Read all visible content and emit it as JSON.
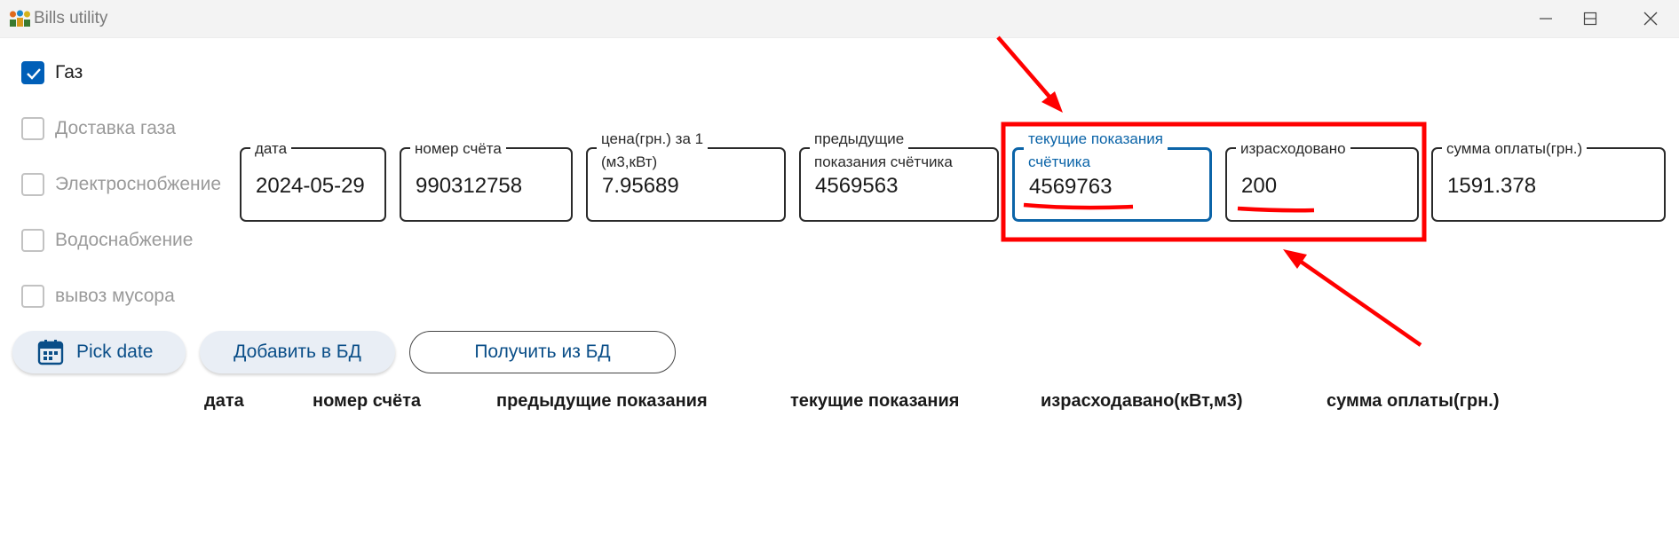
{
  "window": {
    "title": "Bills utility"
  },
  "checkboxes": [
    {
      "label": "Газ",
      "checked": true
    },
    {
      "label": "Доставка газа",
      "checked": false
    },
    {
      "label": "Электроснобжение",
      "checked": false
    },
    {
      "label": "Водоснабжение",
      "checked": false
    },
    {
      "label": "вывоз мусора",
      "checked": false
    }
  ],
  "fields": {
    "date": {
      "label": "дата",
      "value": "2024-05-29"
    },
    "account": {
      "label": "номер счёта",
      "value": "990312758"
    },
    "price": {
      "label_line1": "цена(грн.) за 1",
      "label_line2": "(м3,кВт)",
      "value": "7.95689"
    },
    "previous": {
      "label_line1": "предыдущие",
      "label_line2": "показания счётчика",
      "value": "4569563"
    },
    "current": {
      "label_line1": "текущие показания",
      "label_line2": "счётчика",
      "value": "4569763"
    },
    "consumed": {
      "label": "израсходовано",
      "value": "200"
    },
    "total": {
      "label": "сумма оплаты(грн.)",
      "value": "1591.378"
    }
  },
  "buttons": {
    "pick_date": "Pick date",
    "add_db": "Добавить в БД",
    "get_db": "Получить из БД"
  },
  "table": {
    "columns": [
      "дата",
      "номер счёта",
      "предыдущие показания",
      "текущие показания",
      "израсходавано(кВт,м3)",
      "сумма оплаты(грн.)"
    ]
  },
  "colors": {
    "accent": "#005fb8",
    "annotation": "#ff0000"
  }
}
